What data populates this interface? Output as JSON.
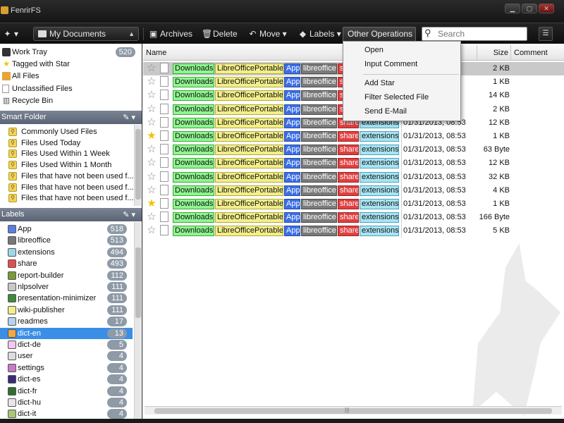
{
  "window": {
    "title": "FenrirFS"
  },
  "toolbar": {
    "location": "My Documents",
    "archives": "Archives",
    "delete": "Delete",
    "move": "Move",
    "labels": "Labels",
    "other_operations": "Other Operations",
    "search_placeholder": "Search"
  },
  "nav": [
    {
      "label": "Work Tray",
      "count": "520"
    },
    {
      "label": "Tagged with Star"
    },
    {
      "label": "All Files"
    },
    {
      "label": "Unclassified Files"
    },
    {
      "label": "Recycle Bin"
    }
  ],
  "smart_folder": {
    "title": "Smart Folder",
    "items": [
      "Commonly Used Files",
      "Files Used Today",
      "Files Used Within 1 Week",
      "Files Used Within 1 Month",
      "Files that have not been used f...",
      "Files that have not been used f...",
      "Files that have not been used f..."
    ]
  },
  "labels_section": {
    "title": "Labels",
    "items": [
      {
        "name": "App",
        "count": "518",
        "color": "#5b7fe0"
      },
      {
        "name": "libreoffice",
        "count": "513",
        "color": "#777777"
      },
      {
        "name": "extensions",
        "count": "494",
        "color": "#9fd7e8"
      },
      {
        "name": "share",
        "count": "493",
        "color": "#e05050"
      },
      {
        "name": "report-builder",
        "count": "112",
        "color": "#7a9a3a"
      },
      {
        "name": "nlpsolver",
        "count": "111",
        "color": "#c8c8c8"
      },
      {
        "name": "presentation-minimizer",
        "count": "111",
        "color": "#3e8a3e"
      },
      {
        "name": "wiki-publisher",
        "count": "111",
        "color": "#f2ee8a"
      },
      {
        "name": "readmes",
        "count": "17",
        "color": "#b5d3f2"
      },
      {
        "name": "dict-en",
        "count": "13",
        "color": "#f2a840"
      },
      {
        "name": "dict-de",
        "count": "5",
        "color": "#f5c8f2"
      },
      {
        "name": "user",
        "count": "4",
        "color": "#dddddd"
      },
      {
        "name": "settings",
        "count": "4",
        "color": "#c879c8"
      },
      {
        "name": "dict-es",
        "count": "4",
        "color": "#3a2a7a"
      },
      {
        "name": "dict-fr",
        "count": "4",
        "color": "#2f6e2f"
      },
      {
        "name": "dict-hu",
        "count": "4",
        "color": "#e6e6e6"
      },
      {
        "name": "dict-it",
        "count": "4",
        "color": "#a8c878"
      }
    ]
  },
  "columns": {
    "name": "Name",
    "size": "Size",
    "comment": "Comment"
  },
  "tags": [
    {
      "text": "Downloads",
      "bg": "#8ff58f",
      "border": "#3aa83a"
    },
    {
      "text": "LibreOfficePortable",
      "bg": "#f2ee8a",
      "border": "#b5a83a"
    },
    {
      "text": "App",
      "bg": "#3a6fe6",
      "border": "#2a4aa8",
      "fg": "#ffffff"
    },
    {
      "text": "libreoffice",
      "bg": "#7a7a7a",
      "border": "#4a4a4a",
      "fg": "#ffffff"
    },
    {
      "text": "share",
      "bg": "#e04040",
      "border": "#a02020",
      "fg": "#ffffff"
    },
    {
      "text": "extensions",
      "bg": "#a8e4f2",
      "border": "#4aa0c0"
    }
  ],
  "files": [
    {
      "date": "",
      "size": "2 KB",
      "star": false
    },
    {
      "date": "",
      "size": "1 KB",
      "star": false
    },
    {
      "date": "",
      "size": "14 KB",
      "star": false
    },
    {
      "date": "",
      "size": "2 KB",
      "star": false
    },
    {
      "date": "01/31/2013, 08:53",
      "size": "12 KB",
      "star": false
    },
    {
      "date": "01/31/2013, 08:53",
      "size": "1 KB",
      "star": true
    },
    {
      "date": "01/31/2013, 08:53",
      "size": "63 Byte",
      "star": false
    },
    {
      "date": "01/31/2013, 08:53",
      "size": "12 KB",
      "star": false
    },
    {
      "date": "01/31/2013, 08:53",
      "size": "32 KB",
      "star": false
    },
    {
      "date": "01/31/2013, 08:53",
      "size": "4 KB",
      "star": false
    },
    {
      "date": "01/31/2013, 08:53",
      "size": "1 KB",
      "star": true
    },
    {
      "date": "01/31/2013, 08:53",
      "size": "166 Byte",
      "star": false
    },
    {
      "date": "01/31/2013, 08:53",
      "size": "5 KB",
      "star": false
    }
  ],
  "context_menu": [
    "Open",
    "Input Comment",
    "Add Star",
    "Filter Selected File",
    "Send E-Mail"
  ]
}
